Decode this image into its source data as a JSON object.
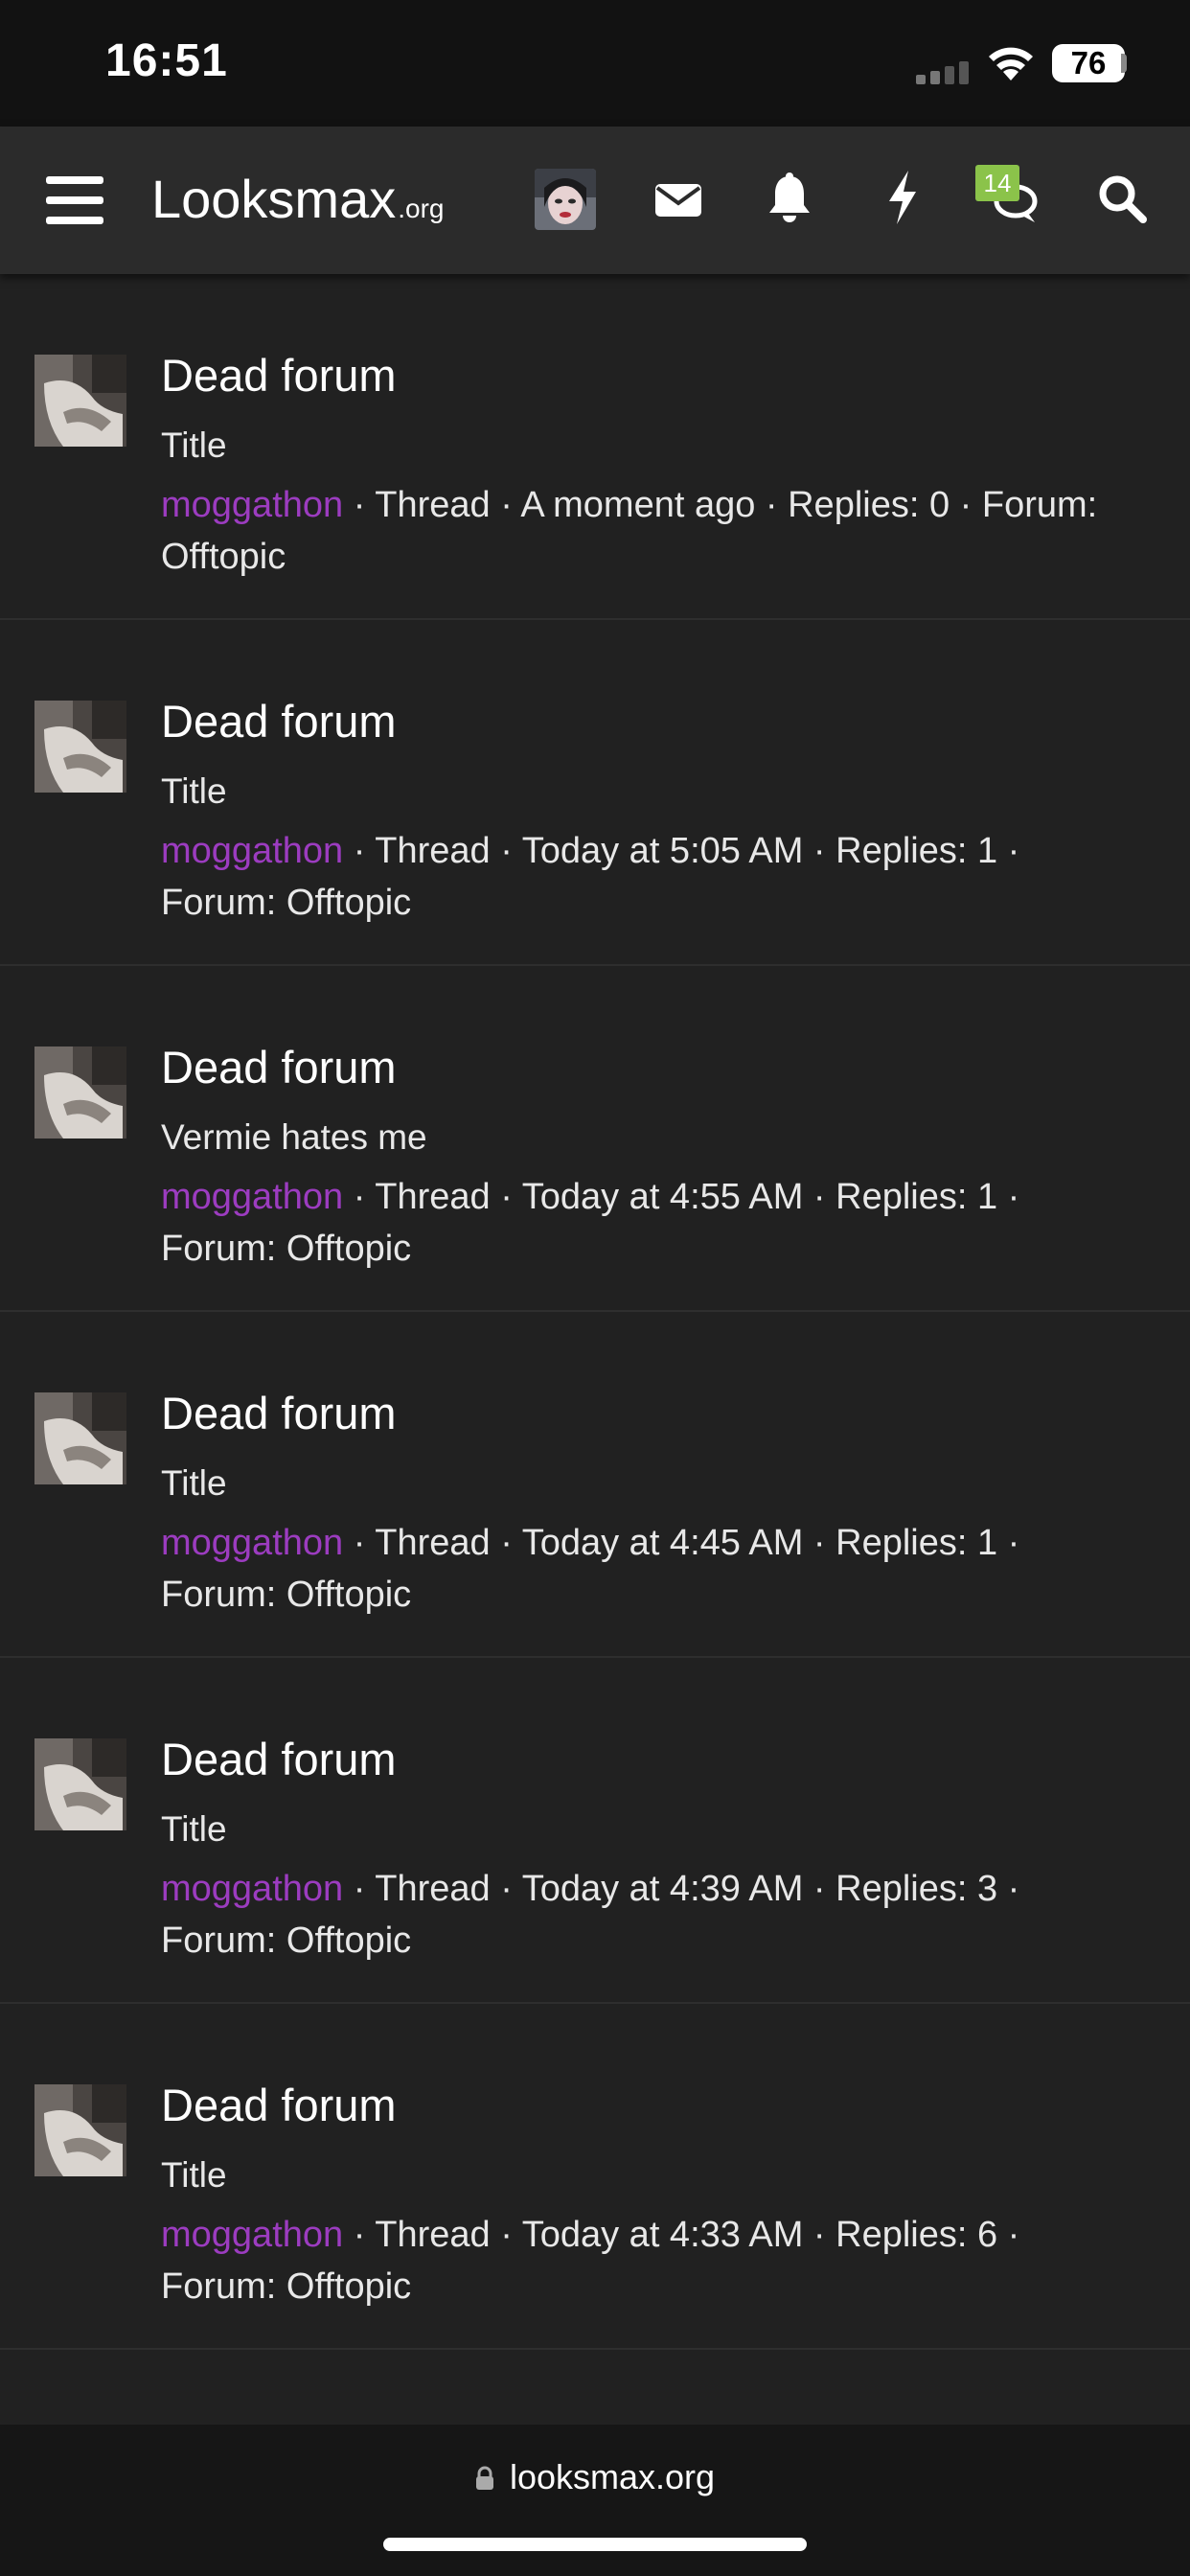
{
  "status_bar": {
    "time": "16:51",
    "battery": "76",
    "signal_icon": "cellular-signal-icon",
    "wifi_icon": "wifi-icon"
  },
  "nav": {
    "menu_icon": "hamburger-menu-icon",
    "logo_main": "Looksmax",
    "logo_suffix": ".org",
    "avatar": "user-avatar",
    "mail_icon": "envelope-icon",
    "bell_icon": "bell-icon",
    "bolt_icon": "lightning-bolt-icon",
    "chat_icon": "chat-bubble-icon",
    "chat_badge": "14",
    "search_icon": "magnifying-glass-icon",
    "badge_color": "#8bc34a"
  },
  "colors": {
    "author": "#9c3cc0",
    "background": "#212121",
    "nav_background": "#2b2b2b"
  },
  "results": [
    {
      "title": "Dead forum",
      "snippet": "Title",
      "author": "moggathon",
      "meta": " · Thread · A moment ago · Replies: 0 · Forum: Offtopic"
    },
    {
      "title": "Dead forum",
      "snippet": "Title",
      "author": "moggathon",
      "meta": " · Thread · Today at 5:05 AM · Replies: 1 · Forum: Offtopic"
    },
    {
      "title": "Dead forum",
      "snippet": "Vermie hates me",
      "author": "moggathon",
      "meta": " · Thread · Today at 4:55 AM · Replies: 1 · Forum: Offtopic"
    },
    {
      "title": "Dead forum",
      "snippet": "Title",
      "author": "moggathon",
      "meta": " · Thread · Today at 4:45 AM · Replies: 1 · Forum: Offtopic"
    },
    {
      "title": "Dead forum",
      "snippet": "Title",
      "author": "moggathon",
      "meta": " · Thread · Today at 4:39 AM · Replies: 3 · Forum: Offtopic"
    },
    {
      "title": "Dead forum",
      "snippet": "Title",
      "author": "moggathon",
      "meta": " · Thread · Today at 4:33 AM · Replies: 6 · Forum: Offtopic"
    }
  ],
  "bottom_bar": {
    "url": "looksmax.org",
    "lock_icon": "lock-icon"
  }
}
